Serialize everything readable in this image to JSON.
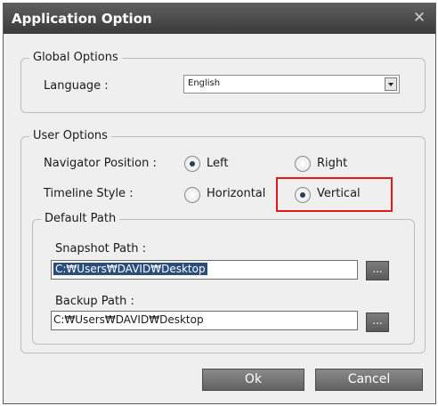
{
  "window": {
    "title": "Application Option",
    "close_glyph": "✕"
  },
  "global_options": {
    "legend": "Global Options",
    "language_label": "Language :",
    "language_value": "English"
  },
  "user_options": {
    "legend": "User Options",
    "navigator_label": "Navigator Position :",
    "navigator_options": [
      "Left",
      "Right"
    ],
    "navigator_selected": "Left",
    "timeline_label": "Timeline Style :",
    "timeline_options": [
      "Horizontal",
      "Vertical"
    ],
    "timeline_selected": "Vertical"
  },
  "default_path": {
    "legend": "Default Path",
    "snapshot_label": "Snapshot Path :",
    "snapshot_value": "C:₩Users₩DAVID₩Desktop",
    "backup_label": "Backup Path :",
    "backup_value": "C:₩Users₩DAVID₩Desktop",
    "browse_label": "..."
  },
  "buttons": {
    "ok": "Ok",
    "cancel": "Cancel"
  },
  "colors": {
    "highlight": "#e01a1a",
    "titlebar": "#4a4a4a",
    "selection": "#2a4d7b"
  }
}
